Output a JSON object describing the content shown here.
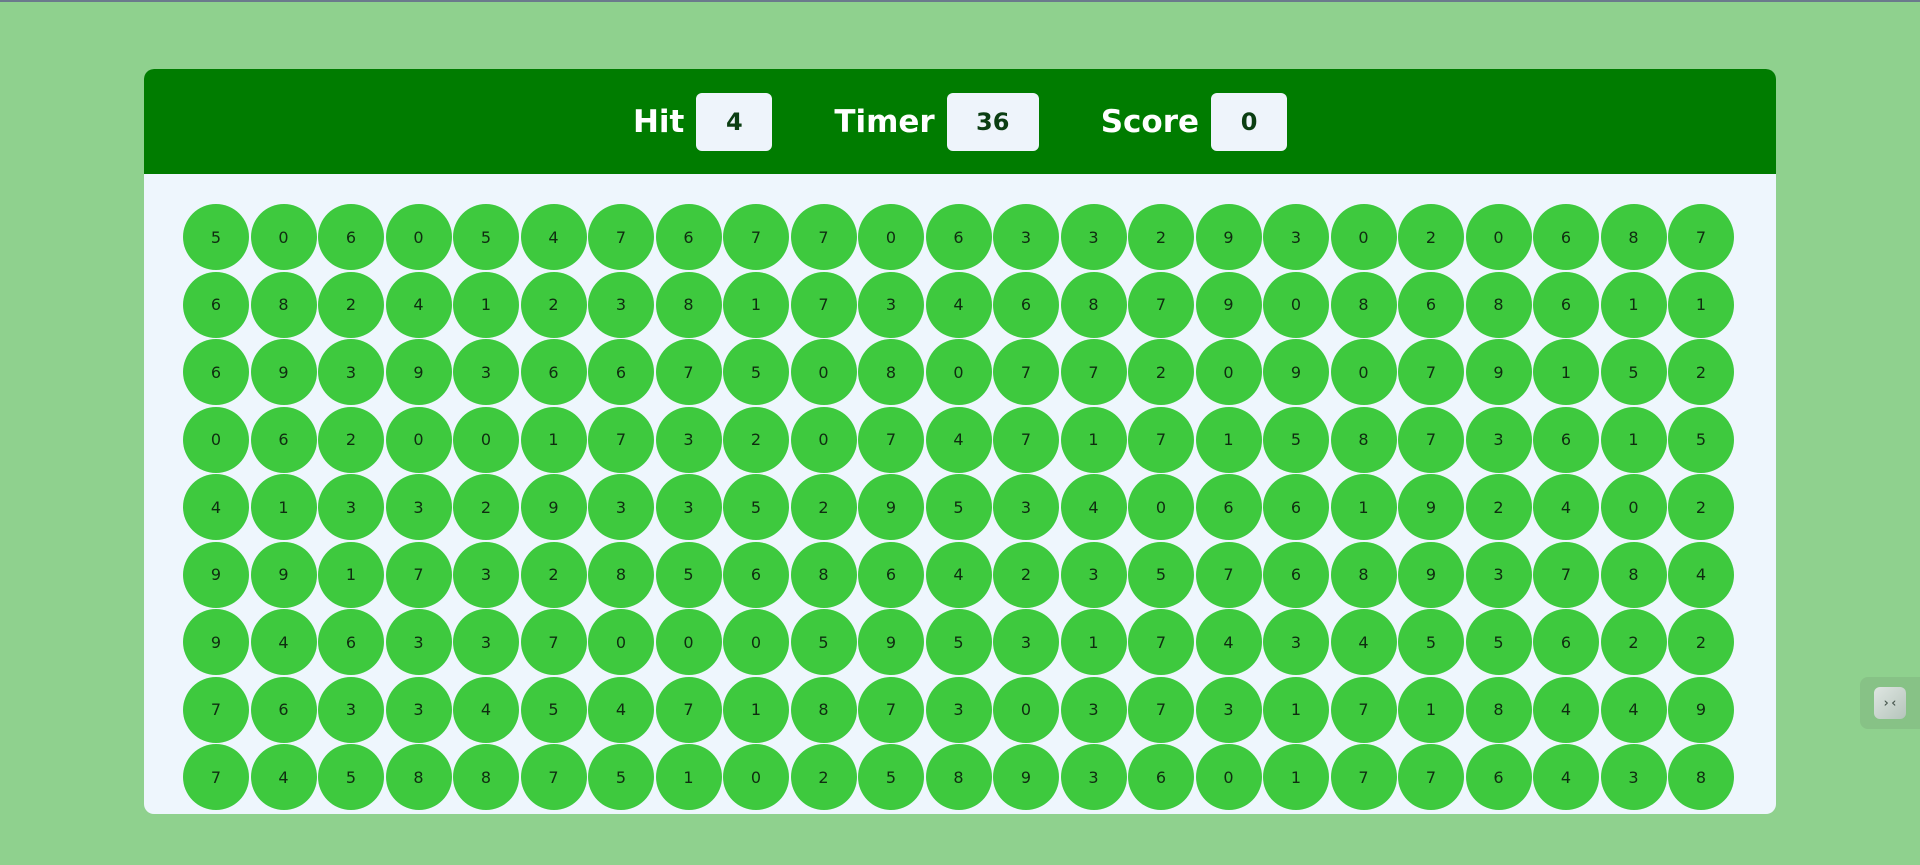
{
  "header": {
    "hit_label": "Hit",
    "hit_value": "4",
    "timer_label": "Timer",
    "timer_value": "36",
    "score_label": "Score",
    "score_value": "0"
  },
  "colors": {
    "page_background": "#8fd18e",
    "header_background": "#007c00",
    "board_background": "#eef6fd",
    "ball": "#3ec93e"
  },
  "board": {
    "rows": [
      [
        "5",
        "0",
        "6",
        "0",
        "5",
        "4",
        "7",
        "6",
        "7",
        "7",
        "0",
        "6",
        "3",
        "3",
        "2",
        "9",
        "3",
        "0",
        "2",
        "0",
        "6",
        "8",
        "7"
      ],
      [
        "6",
        "8",
        "2",
        "4",
        "1",
        "2",
        "3",
        "8",
        "1",
        "7",
        "3",
        "4",
        "6",
        "8",
        "7",
        "9",
        "0",
        "8",
        "6",
        "8",
        "6",
        "1",
        "1"
      ],
      [
        "6",
        "9",
        "3",
        "9",
        "3",
        "6",
        "6",
        "7",
        "5",
        "0",
        "8",
        "0",
        "7",
        "7",
        "2",
        "0",
        "9",
        "0",
        "7",
        "9",
        "1",
        "5",
        "2"
      ],
      [
        "0",
        "6",
        "2",
        "0",
        "0",
        "1",
        "7",
        "3",
        "2",
        "0",
        "7",
        "4",
        "7",
        "1",
        "7",
        "1",
        "5",
        "8",
        "7",
        "3",
        "6",
        "1",
        "5"
      ],
      [
        "4",
        "1",
        "3",
        "3",
        "2",
        "9",
        "3",
        "3",
        "5",
        "2",
        "9",
        "5",
        "3",
        "4",
        "0",
        "6",
        "6",
        "1",
        "9",
        "2",
        "4",
        "0",
        "2"
      ],
      [
        "9",
        "9",
        "1",
        "7",
        "3",
        "2",
        "8",
        "5",
        "6",
        "8",
        "6",
        "4",
        "2",
        "3",
        "5",
        "7",
        "6",
        "8",
        "9",
        "3",
        "7",
        "8",
        "4"
      ],
      [
        "9",
        "4",
        "6",
        "3",
        "3",
        "7",
        "0",
        "0",
        "0",
        "5",
        "9",
        "5",
        "3",
        "1",
        "7",
        "4",
        "3",
        "4",
        "5",
        "5",
        "6",
        "2",
        "2"
      ],
      [
        "7",
        "6",
        "3",
        "3",
        "4",
        "5",
        "4",
        "7",
        "1",
        "8",
        "7",
        "3",
        "0",
        "3",
        "7",
        "3",
        "1",
        "7",
        "1",
        "8",
        "4",
        "4",
        "9"
      ],
      [
        "7",
        "4",
        "5",
        "8",
        "8",
        "7",
        "5",
        "1",
        "0",
        "2",
        "5",
        "8",
        "9",
        "3",
        "6",
        "0",
        "1",
        "7",
        "7",
        "6",
        "4",
        "3",
        "8"
      ]
    ]
  },
  "side_widget": {
    "icon": "collapse-icon",
    "glyph": "›‹"
  }
}
